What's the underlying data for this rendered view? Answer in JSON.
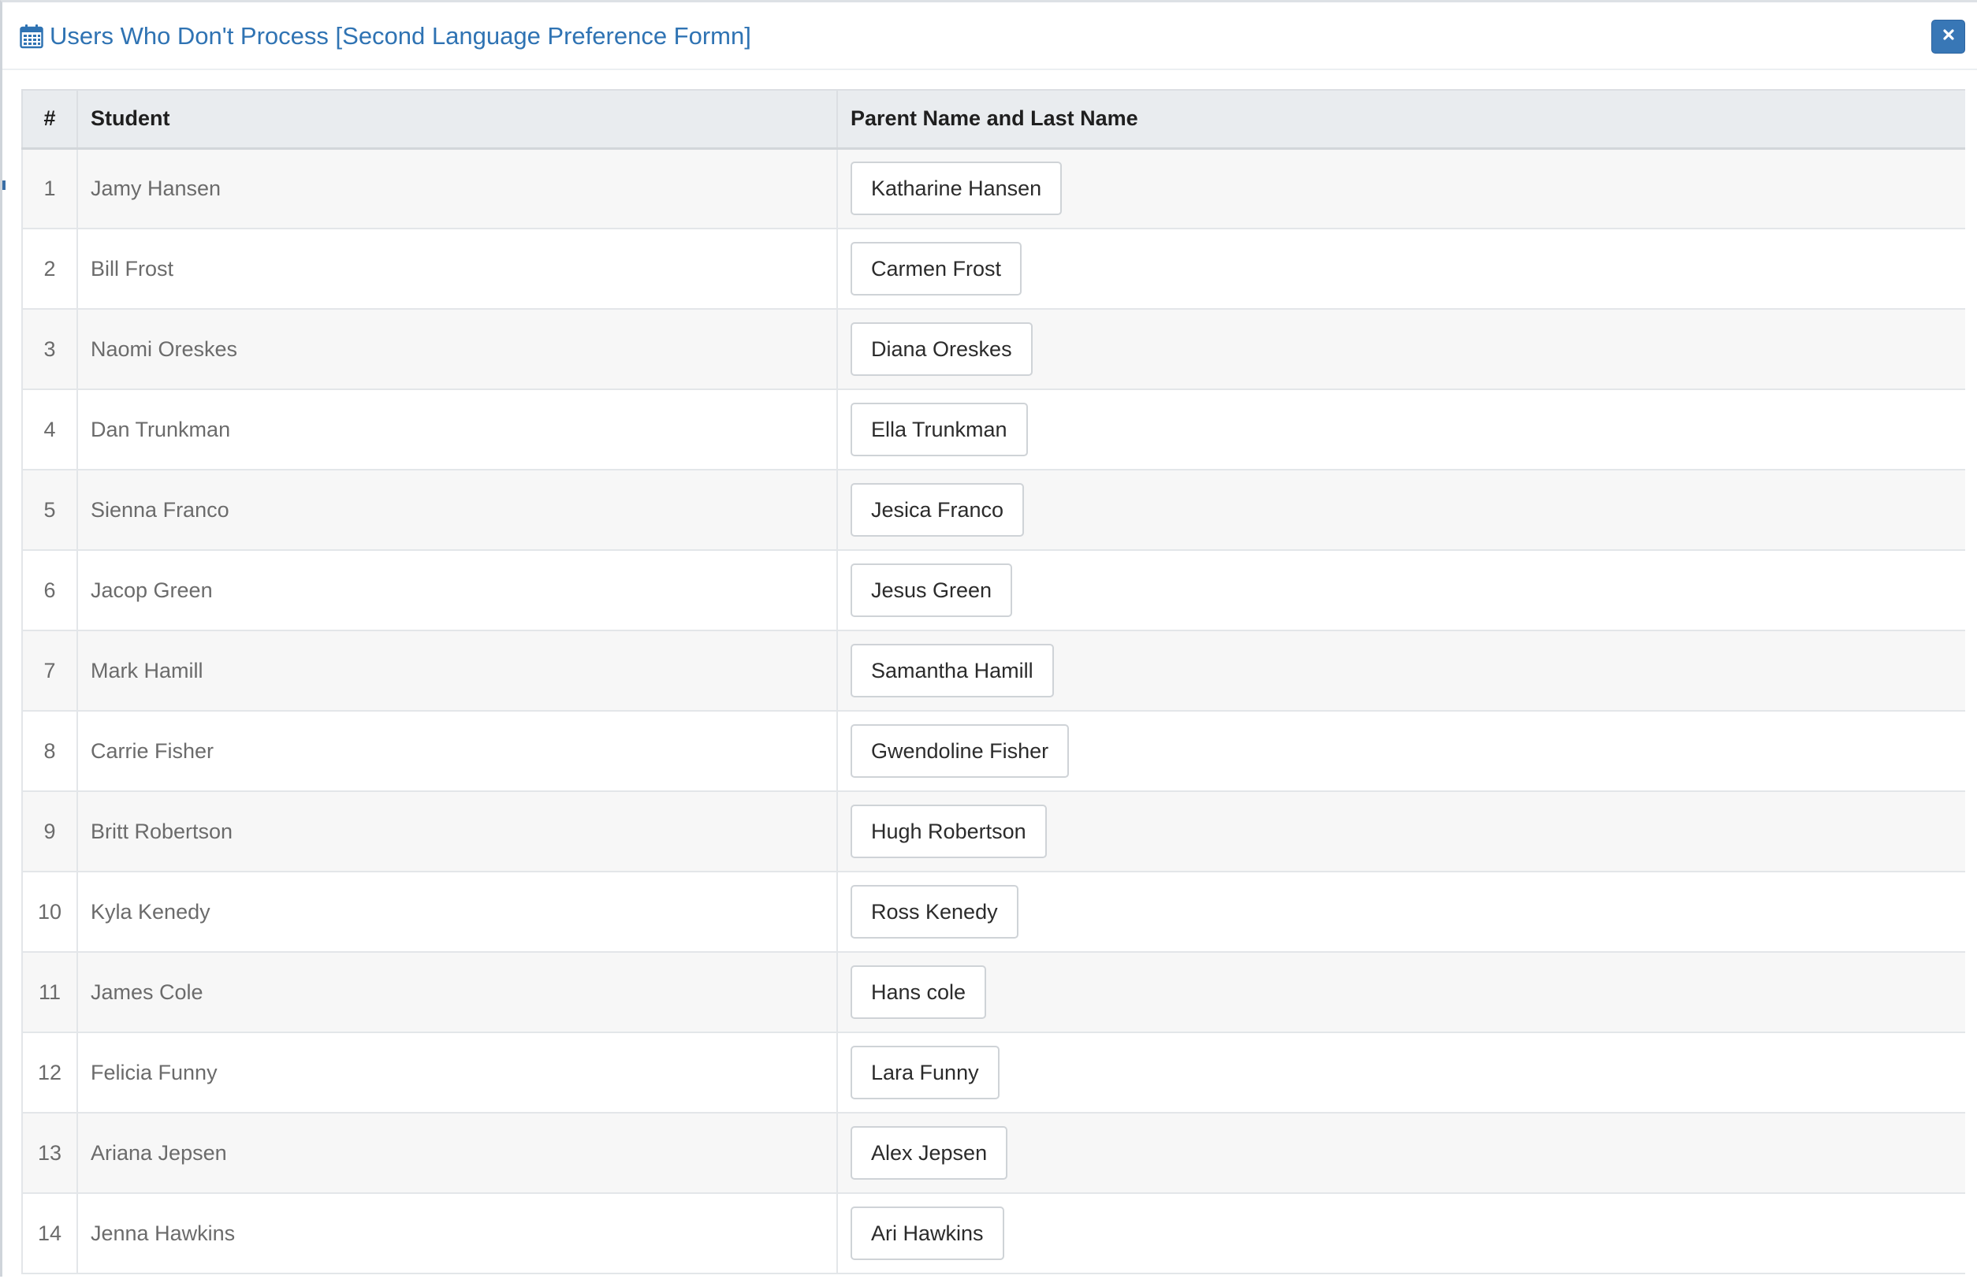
{
  "modal": {
    "title": "Users Who Don't Process [Second Language Preference Formn]",
    "title_icon": "calendar-icon",
    "close_icon": "close-icon",
    "accent_color": "#2f73b3",
    "close_button_color": "#3877b6"
  },
  "table": {
    "columns": [
      "#",
      "Student",
      "Parent Name and Last Name"
    ],
    "rows": [
      {
        "num": "1",
        "student": "Jamy Hansen",
        "parent": "Katharine Hansen"
      },
      {
        "num": "2",
        "student": "Bill Frost",
        "parent": "Carmen Frost"
      },
      {
        "num": "3",
        "student": "Naomi Oreskes",
        "parent": "Diana Oreskes"
      },
      {
        "num": "4",
        "student": "Dan Trunkman",
        "parent": "Ella Trunkman"
      },
      {
        "num": "5",
        "student": "Sienna Franco",
        "parent": "Jesica Franco"
      },
      {
        "num": "6",
        "student": "Jacop Green",
        "parent": "Jesus Green"
      },
      {
        "num": "7",
        "student": "Mark Hamill",
        "parent": "Samantha Hamill"
      },
      {
        "num": "8",
        "student": "Carrie Fisher",
        "parent": "Gwendoline Fisher"
      },
      {
        "num": "9",
        "student": "Britt Robertson",
        "parent": "Hugh Robertson"
      },
      {
        "num": "10",
        "student": "Kyla Kenedy",
        "parent": "Ross Kenedy"
      },
      {
        "num": "11",
        "student": "James Cole",
        "parent": "Hans cole"
      },
      {
        "num": "12",
        "student": "Felicia Funny",
        "parent": "Lara Funny"
      },
      {
        "num": "13",
        "student": "Ariana Jepsen",
        "parent": "Alex Jepsen"
      },
      {
        "num": "14",
        "student": "Jenna Hawkins",
        "parent": "Ari Hawkins"
      }
    ]
  }
}
